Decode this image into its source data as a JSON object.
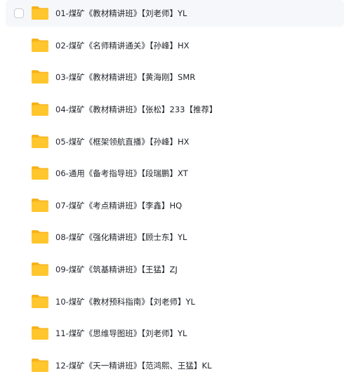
{
  "colors": {
    "folder_body": "#FFC62D",
    "folder_tab": "#F9B21A",
    "text": "#1F2329",
    "hover_row": "#F5F7FA",
    "checkbox_border": "#C9CCD1"
  },
  "icon": "folder-icon",
  "files": [
    {
      "name": "01-煤矿《教材精讲班》【刘老师】YL",
      "type": "folder",
      "hovered": true
    },
    {
      "name": "02-煤矿《名师精讲通关》【孙峰】HX",
      "type": "folder"
    },
    {
      "name": "03-煤矿《教材精讲班》【黄海刚】SMR",
      "type": "folder"
    },
    {
      "name": "04-煤矿《教材精讲班》【张松】233【推荐】",
      "type": "folder"
    },
    {
      "name": "05-煤矿《框架领航直播》【孙峰】HX",
      "type": "folder"
    },
    {
      "name": "06-通用《备考指导班》【段瑞鹏】XT",
      "type": "folder"
    },
    {
      "name": "07-煤矿《考点精讲班》【李鑫】HQ",
      "type": "folder"
    },
    {
      "name": "08-煤矿《强化精讲班》【顾士东】YL",
      "type": "folder"
    },
    {
      "name": "09-煤矿《筑基精讲班》【王猛】ZJ",
      "type": "folder"
    },
    {
      "name": "10-煤矿《教材预科指南》【刘老师】YL",
      "type": "folder"
    },
    {
      "name": "11-煤矿《思维导图班》【刘老师】YL",
      "type": "folder"
    },
    {
      "name": "12-煤矿《天一精讲班》【范鸿熙、王猛】KL",
      "type": "folder"
    }
  ]
}
